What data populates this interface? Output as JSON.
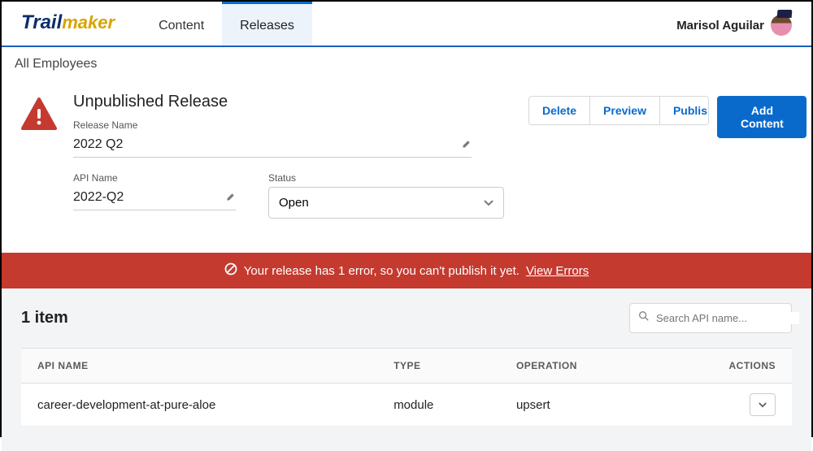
{
  "brand": {
    "part1": "Trail",
    "part2": "maker"
  },
  "nav": {
    "tabs": [
      {
        "label": "Content"
      },
      {
        "label": "Releases"
      }
    ],
    "active_index": 1
  },
  "user": {
    "name": "Marisol Aguilar"
  },
  "breadcrumb": "All Employees",
  "release": {
    "title": "Unpublished Release",
    "fields": {
      "release_name": {
        "label": "Release Name",
        "value": "2022 Q2"
      },
      "api_name": {
        "label": "API Name",
        "value": "2022-Q2"
      },
      "status": {
        "label": "Status",
        "value": "Open"
      }
    }
  },
  "actions": {
    "delete": "Delete",
    "preview": "Preview",
    "publish": "Publish",
    "add_content": "Add Content"
  },
  "error": {
    "message": "Your release has 1 error, so you can't publish it yet.",
    "link": "View Errors"
  },
  "list": {
    "count_label": "1 item",
    "search_placeholder": "Search API name...",
    "columns": {
      "api_name": "API NAME",
      "type": "TYPE",
      "operation": "OPERATION",
      "actions": "ACTIONS"
    },
    "rows": [
      {
        "api_name": "career-development-at-pure-aloe",
        "type": "module",
        "operation": "upsert"
      }
    ]
  }
}
